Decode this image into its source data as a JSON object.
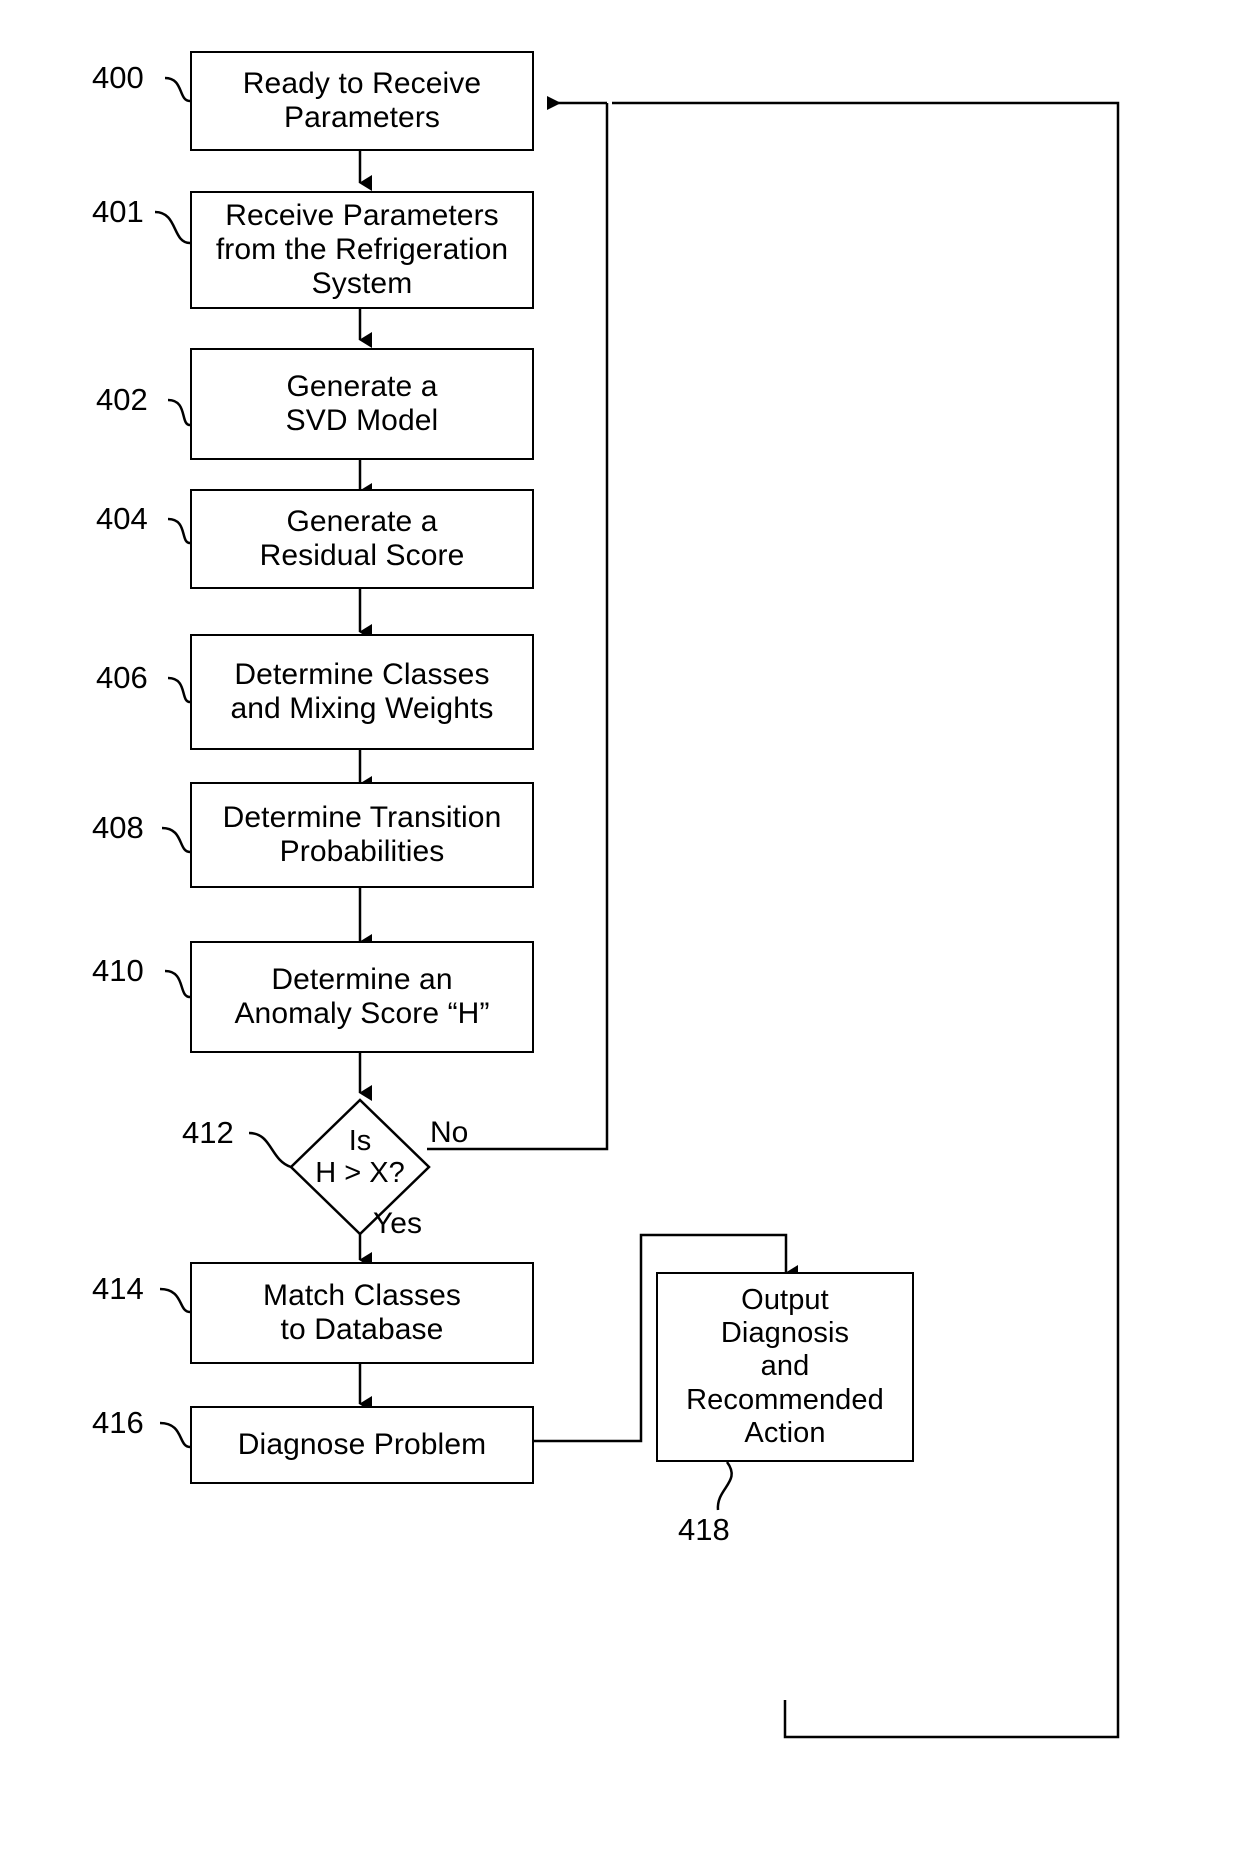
{
  "figure": {
    "type": "flowchart",
    "title": "",
    "background_color": "#ffffff",
    "line_color": "#000000"
  },
  "nodes": [
    {
      "ref": "400",
      "name": "ready-to-receive-parameters",
      "shape": "process",
      "label": "Ready to Receive\nParameters"
    },
    {
      "ref": "401",
      "name": "receive-parameters",
      "shape": "process",
      "label": "Receive Parameters\nfrom the Refrigeration\nSystem"
    },
    {
      "ref": "402",
      "name": "generate-svd-model",
      "shape": "process",
      "label": "Generate a\nSVD Model"
    },
    {
      "ref": "404",
      "name": "generate-residual-score",
      "shape": "process",
      "label": "Generate a\nResidual Score"
    },
    {
      "ref": "406",
      "name": "determine-classes-and-mixing-weights",
      "shape": "process",
      "label": "Determine Classes\nand Mixing Weights"
    },
    {
      "ref": "408",
      "name": "determine-transition-probabilities",
      "shape": "process",
      "label": "Determine Transition\nProbabilities"
    },
    {
      "ref": "410",
      "name": "determine-anomaly-score",
      "shape": "process",
      "label": "Determine an\nAnomaly Score “H”"
    },
    {
      "ref": "412",
      "name": "decision-is-h-greater-than-x",
      "shape": "decision",
      "label": "Is\nH > X?"
    },
    {
      "ref": "414",
      "name": "match-classes-to-database",
      "shape": "process",
      "label": "Match Classes\nto Database"
    },
    {
      "ref": "416",
      "name": "diagnose-problem",
      "shape": "process",
      "label": "Diagnose Problem"
    },
    {
      "ref": "418",
      "name": "output-diagnosis-and-recommended-action",
      "shape": "process",
      "label": "Output\nDiagnosis\nand\nRecommended\nAction"
    }
  ],
  "branch_labels": {
    "no": "No",
    "yes": "Yes"
  },
  "reference_numerals": [
    "400",
    "401",
    "402",
    "404",
    "406",
    "408",
    "410",
    "412",
    "414",
    "416",
    "418"
  ]
}
